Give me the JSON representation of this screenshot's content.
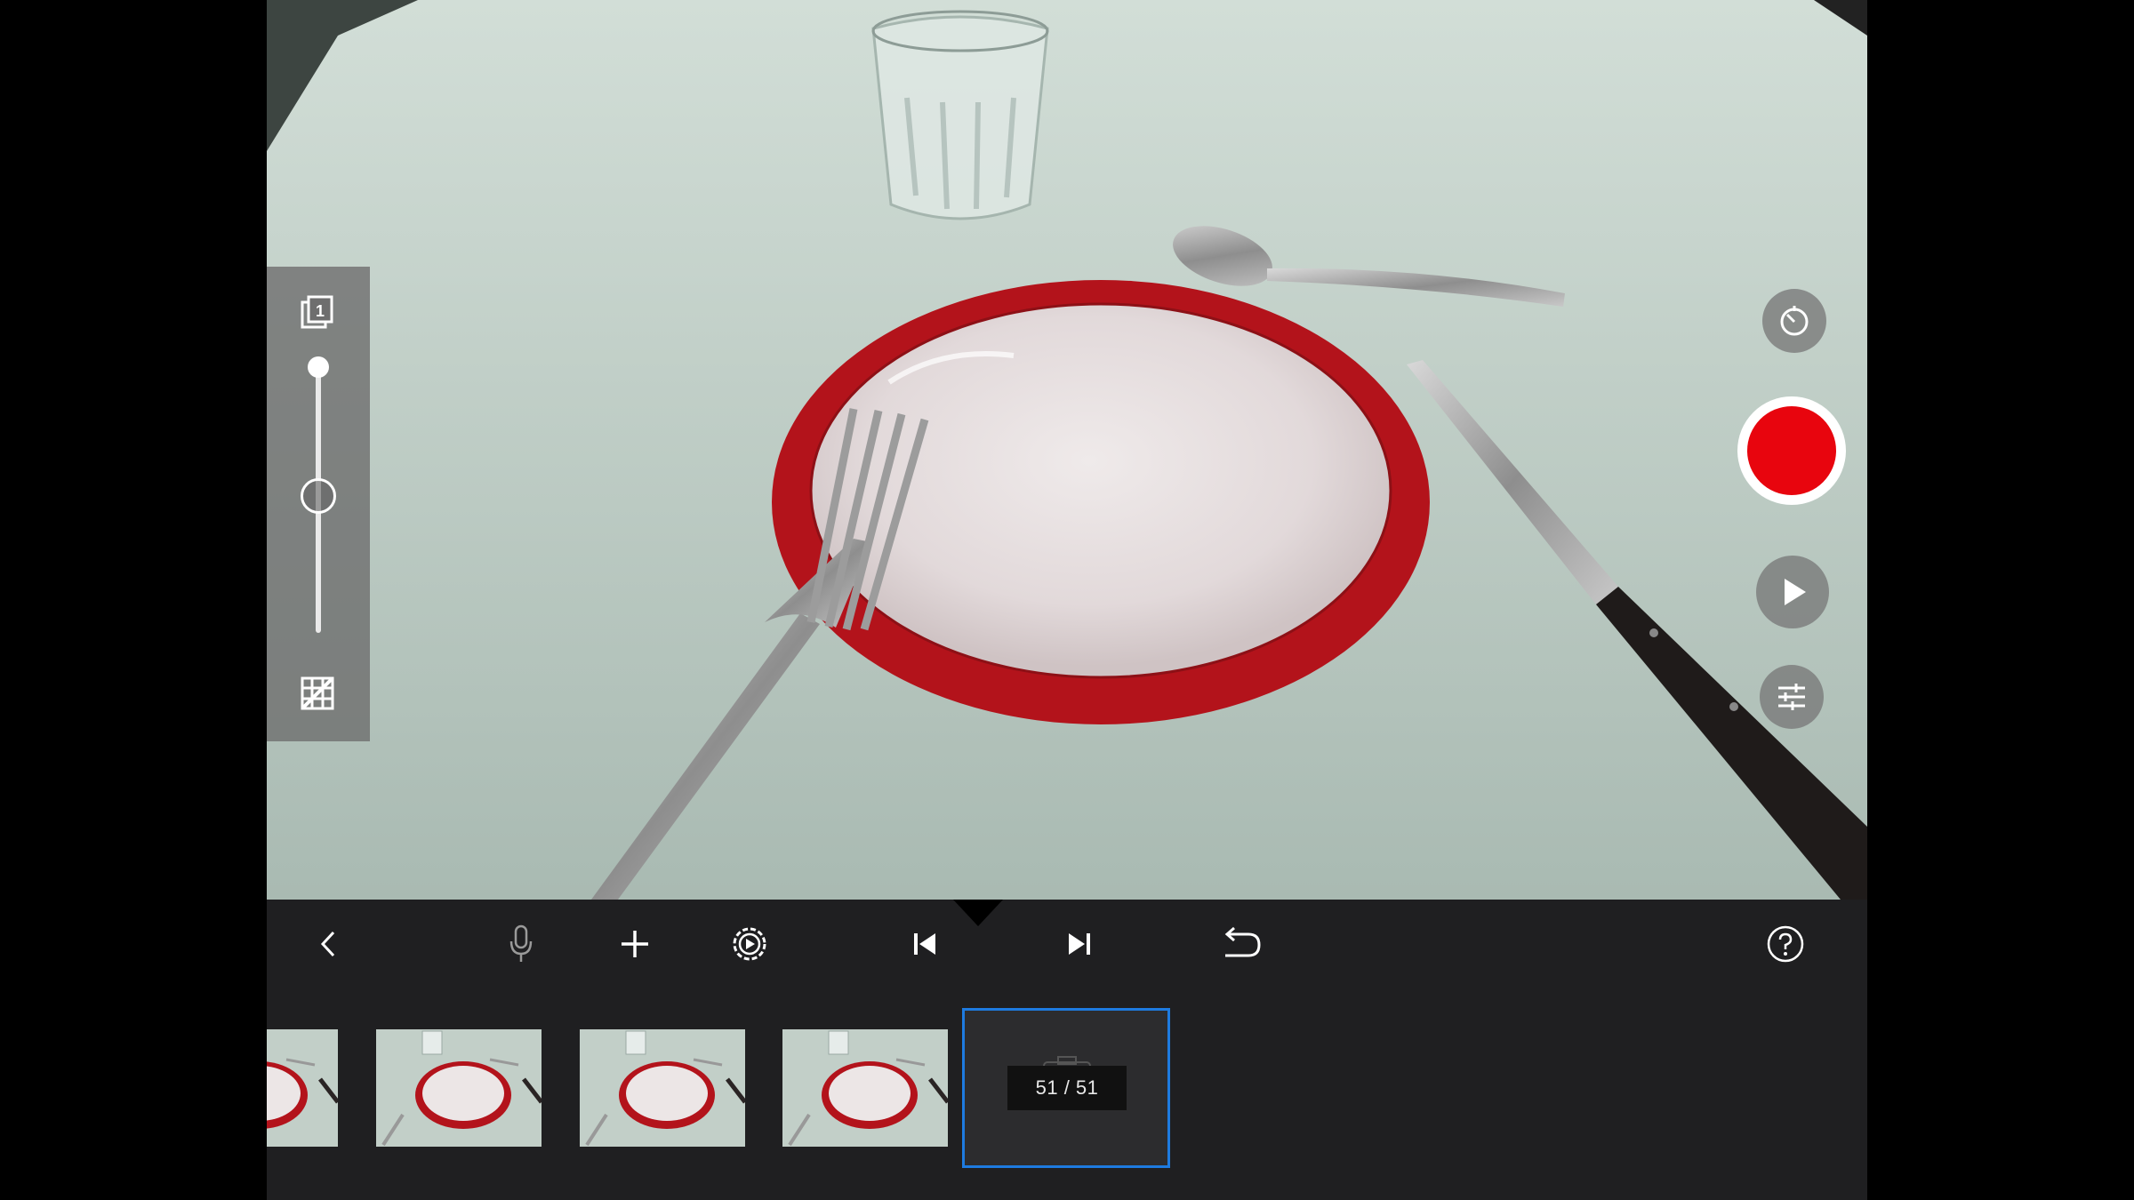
{
  "app": {
    "name": "stop-motion-capture"
  },
  "left_panel": {
    "onion_skin_icon": "layers-icon",
    "onion_skin_value": "1",
    "grid_icon": "grid-off-icon",
    "opacity_slider": {
      "level": 0.53
    }
  },
  "right_controls": {
    "timer_icon": "timer-icon",
    "record_icon": "record-icon",
    "record_color": "#e8050e",
    "play_icon": "play-icon",
    "adjust_icon": "sliders-icon"
  },
  "toolbar": {
    "back_icon": "chevron-left-icon",
    "mic_icon": "microphone-icon",
    "add_icon": "plus-icon",
    "camera_settings_icon": "camera-settings-icon",
    "prev_icon": "skip-back-icon",
    "next_icon": "skip-forward-icon",
    "undo_icon": "undo-icon",
    "help_icon": "help-icon"
  },
  "filmstrip": {
    "thumbnails": [
      "frame-48",
      "frame-49",
      "frame-50",
      "frame-51"
    ],
    "frame_counter": "51 / 51",
    "selection_color": "#1e7be0"
  }
}
